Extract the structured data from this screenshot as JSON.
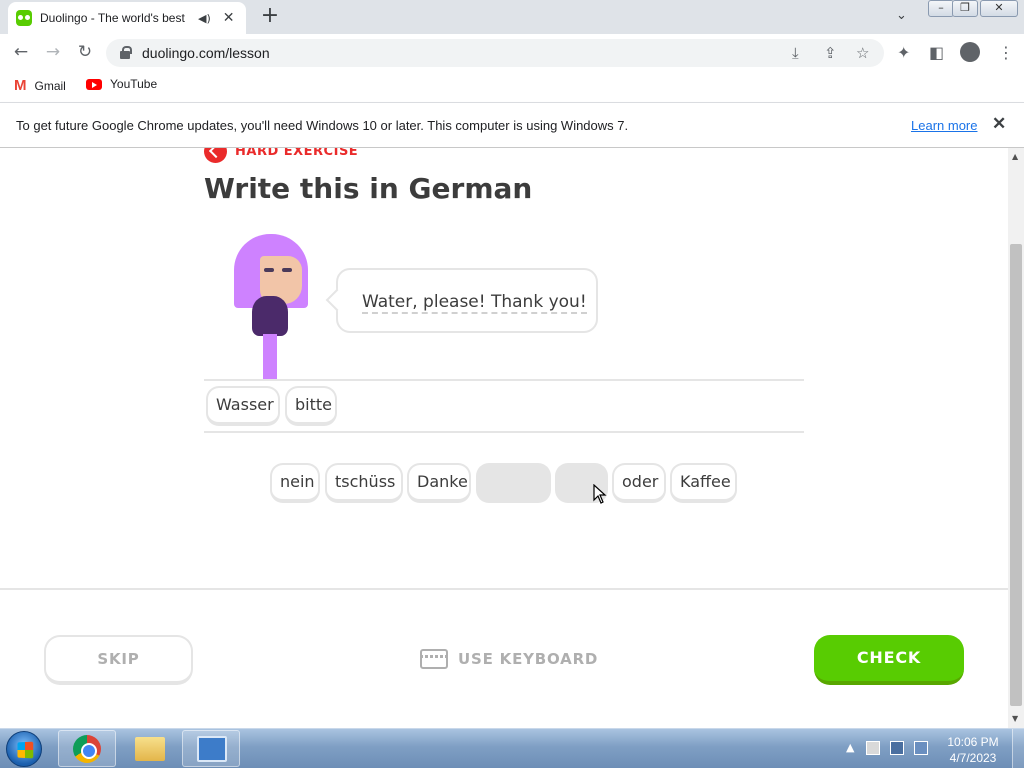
{
  "browser": {
    "tab_title": "Duolingo - The world's best",
    "new_tab_symbol": "+",
    "url": "duolingo.com/lesson",
    "bookmarks": [
      {
        "label": "Gmail",
        "icon": "gmail-icon"
      },
      {
        "label": "YouTube",
        "icon": "youtube-icon"
      }
    ],
    "infobar": {
      "message": "To get future Google Chrome updates, you'll need Windows 10 or later. This computer is using Windows 7.",
      "link": "Learn more"
    }
  },
  "lesson": {
    "badge": "HARD EXERCISE",
    "heading": "Write this in German",
    "prompt": "Water, please! Thank you!",
    "answer_words": [
      "Wasser",
      "bitte"
    ],
    "word_bank": [
      {
        "label": "nein",
        "used": false
      },
      {
        "label": "tschüss",
        "used": false
      },
      {
        "label": "Danke",
        "used": false
      },
      {
        "label": "",
        "used": true
      },
      {
        "label": "",
        "used": true
      },
      {
        "label": "oder",
        "used": false
      },
      {
        "label": "Kaffee",
        "used": false
      }
    ],
    "skip_label": "SKIP",
    "keyboard_label": "USE KEYBOARD",
    "check_label": "CHECK"
  },
  "colors": {
    "duo_green": "#58cc02",
    "hard_red": "#ea2b2b",
    "border_gray": "#e5e5e5",
    "character_purple": "#ce82ff"
  },
  "taskbar": {
    "time": "10:06 PM",
    "date": "4/7/2023",
    "apps": [
      "chrome-icon",
      "file-explorer-icon",
      "control-panel-icon"
    ]
  }
}
